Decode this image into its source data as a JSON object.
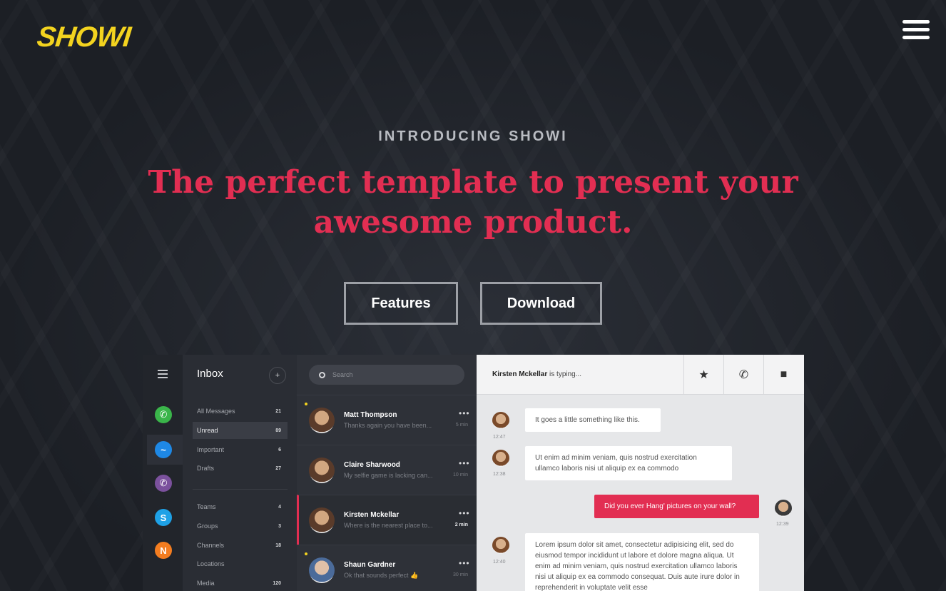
{
  "brand": {
    "logo": "SHOWI"
  },
  "hero": {
    "eyebrow": "INTRODUCING SHOWI",
    "headline": "The perfect template to present your awesome product.",
    "buttons": {
      "features": "Features",
      "download": "Download"
    }
  },
  "colors": {
    "accent": "#e22e52",
    "brand": "#f3d31f",
    "background": "#1e2128"
  },
  "app": {
    "rail_icons": [
      "whatsapp-icon",
      "messenger-icon",
      "viber-icon",
      "skype-icon",
      "n-app-icon"
    ],
    "inbox": {
      "title": "Inbox",
      "folders": [
        {
          "label": "All Messages",
          "count": "21"
        },
        {
          "label": "Unread",
          "count": "89"
        },
        {
          "label": "Important",
          "count": "6"
        },
        {
          "label": "Drafts",
          "count": "27"
        }
      ],
      "groups": [
        {
          "label": "Teams",
          "count": "4"
        },
        {
          "label": "Groups",
          "count": "3"
        },
        {
          "label": "Channels",
          "count": "18"
        },
        {
          "label": "Locations",
          "count": ""
        },
        {
          "label": "Media",
          "count": "120"
        }
      ]
    },
    "search": {
      "placeholder": "Search"
    },
    "conversations": [
      {
        "name": "Matt Thompson",
        "preview": "Thanks again you have been...",
        "time": "5 min"
      },
      {
        "name": "Claire Sharwood",
        "preview": "My selfie game is lacking can...",
        "time": "10 min"
      },
      {
        "name": "Kirsten Mckellar",
        "preview": "Where is the nearest place to...",
        "time": "2 min"
      },
      {
        "name": "Shaun Gardner",
        "preview": "Ok that sounds perfect 👍",
        "time": "30 min"
      }
    ],
    "chat": {
      "typing_name": "Kirsten Mckellar",
      "typing_suffix": " is typing...",
      "messages": [
        {
          "text": "It goes a little something like this.",
          "time": "12:47"
        },
        {
          "text": "Ut enim ad minim veniam, quis nostrud exercitation ullamco laboris nisi ut aliquip ex ea commodo",
          "time": "12:38"
        },
        {
          "text": "Did you ever Hang' pictures on your wall?",
          "time": "12:39"
        },
        {
          "text": "Lorem ipsum dolor sit amet, consectetur adipisicing elit, sed do eiusmod tempor incididunt ut labore et dolore magna aliqua. Ut enim ad minim veniam, quis nostrud exercitation ullamco laboris nisi ut aliquip ex ea commodo consequat. Duis aute irure dolor in reprehenderit in voluptate velit esse",
          "time": "12:40"
        }
      ]
    }
  }
}
